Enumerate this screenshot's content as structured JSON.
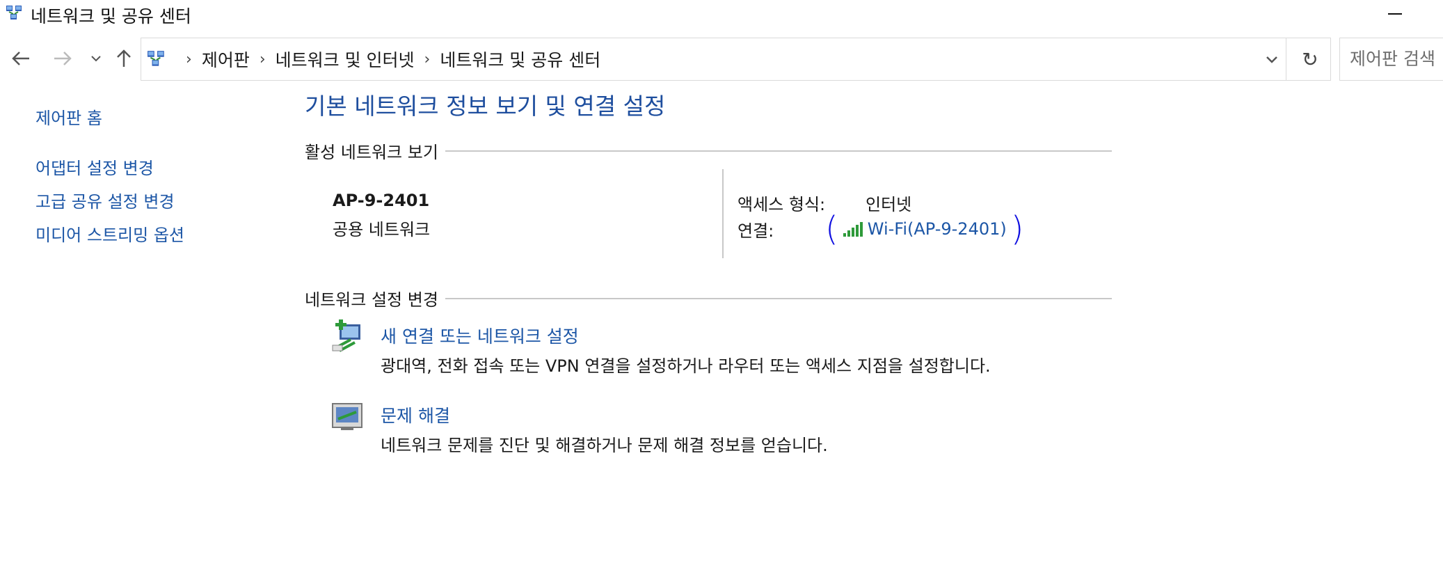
{
  "window": {
    "title": "네트워크 및 공유 센터",
    "app_icon": "network-sharing-icon"
  },
  "nav": {
    "back_icon": "arrow-left-icon",
    "forward_icon": "arrow-right-icon",
    "recent_icon": "chevron-down-icon",
    "up_icon": "arrow-up-icon",
    "breadcrumbs": [
      "제어판",
      "네트워크 및 인터넷",
      "네트워크 및 공유 센터"
    ],
    "refresh_icon": "refresh-icon",
    "search_placeholder": "제어판 검색"
  },
  "sidebar": {
    "items": [
      {
        "label": "제어판 홈"
      },
      {
        "label": "어댑터 설정 변경"
      },
      {
        "label": "고급 공유 설정 변경"
      },
      {
        "label": "미디어 스트리밍 옵션"
      }
    ]
  },
  "main": {
    "title": "기본 네트워크 정보 보기 및 연결 설정",
    "active_section": "활성 네트워크 보기",
    "network": {
      "name": "AP-9-2401",
      "type": "공용 네트워크",
      "access_label": "액세스 형식:",
      "access_value": "인터넷",
      "connection_label": "연결:",
      "connection_value": "Wi-Fi(AP-9-2401)",
      "connection_icon": "wifi-signal-icon"
    },
    "settings_section": "네트워크 설정 변경",
    "tasks": [
      {
        "title": "새 연결 또는 네트워크 설정",
        "desc": "광대역, 전화 접속 또는 VPN 연결을 설정하거나 라우터 또는 액세스 지점을 설정합니다.",
        "icon": "new-connection-icon"
      },
      {
        "title": "문제 해결",
        "desc": "네트워크 문제를 진단 및 해결하거나 문제 해결 정보를 얻습니다.",
        "icon": "troubleshoot-icon"
      }
    ]
  },
  "colors": {
    "link": "#1c56a6",
    "title": "#1e4e9e",
    "annotation": "#1010e0"
  }
}
